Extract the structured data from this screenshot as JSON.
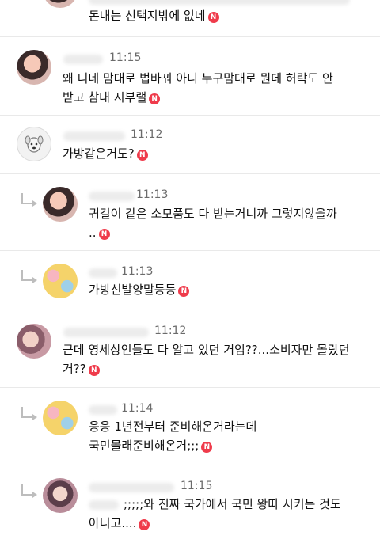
{
  "badge": "N",
  "comments": [
    {
      "id": "c0",
      "name_hint": "",
      "time": "",
      "line1": "",
      "line2": "돈내는 선택지밖에 없네",
      "new": true
    },
    {
      "id": "c1",
      "name_hint": "",
      "time": "11:15",
      "line1": "왜 니네 맘대로 법바꿔 아니 누구맘대로 뭔데 허락도 안",
      "line2": "받고 참내 시부랠",
      "new": true
    },
    {
      "id": "c2",
      "name_hint": "",
      "time": "11:12",
      "line1": "가방같은거도?",
      "line2": "",
      "new": true
    },
    {
      "id": "c3",
      "name_hint": "",
      "time": "11:13",
      "line1": "귀걸이 같은 소모품도 다 받는거니까 그렇지않을까",
      "line2": "..",
      "new": true,
      "reply": true
    },
    {
      "id": "c4",
      "name_hint": "",
      "time": "11:13",
      "line1": "가방신발양말등등",
      "line2": "",
      "new": true,
      "reply": true
    },
    {
      "id": "c5",
      "name_hint": "",
      "time": "11:12",
      "line1": "근데 영세상인들도 다 알고 있던 거임??...소비자만 몰랐던",
      "line2": "거??",
      "new": true
    },
    {
      "id": "c6",
      "name_hint": "",
      "time": "11:14",
      "line1": "응응 1년전부터 준비해온거라는데",
      "line2": "국민몰래준비해온거;;;",
      "new": true,
      "reply": true
    },
    {
      "id": "c7",
      "name_hint": "",
      "time": "11:15",
      "line1": ";;;;;와 진짜 국가에서 국민 왕따 시키는 것도",
      "line2": "아니고....",
      "new": true,
      "reply": true
    }
  ]
}
